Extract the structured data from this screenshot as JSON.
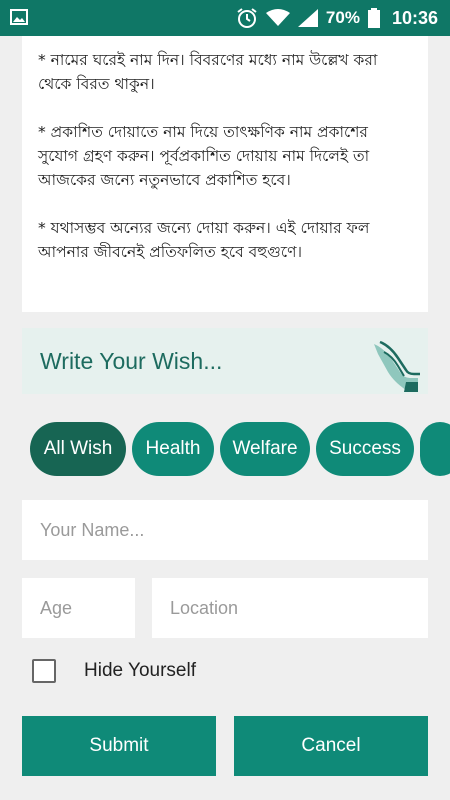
{
  "status_bar": {
    "battery": "70%",
    "time": "10:36",
    "icons": [
      "gallery-icon",
      "alarm-icon",
      "wifi-icon",
      "signal-icon",
      "battery-icon"
    ]
  },
  "info": {
    "paragraphs": [
      "* নামের ঘরেই নাম দিন। বিবরণের মধ্যে নাম উল্লেখ করা থেকে বিরত থাকুন।",
      "* প্রকাশিত দোয়াতে নাম দিয়ে তাৎক্ষণিক নাম প্রকাশের সুযোগ গ্রহণ করুন। পূর্বপ্রকাশিত দোয়ায় নাম দিলেই তা আজকের জন্যে নতুনভাবে প্রকাশিত হবে।",
      "* যথাসম্ভব অন্যের জন্যে দোয়া করুন। এই দোয়ার ফল আপনার জীবনেই প্রতিফলিত হবে বহুগুণে।"
    ]
  },
  "wish_header": {
    "title": "Write Your Wish...",
    "icon": "praying-hands-icon"
  },
  "categories": [
    {
      "label": "All Wish",
      "active": true
    },
    {
      "label": "Health",
      "active": false
    },
    {
      "label": "Welfare",
      "active": false
    },
    {
      "label": "Success",
      "active": false
    }
  ],
  "form": {
    "name_placeholder": "Your Name...",
    "age_placeholder": "Age",
    "location_placeholder": "Location",
    "hide_label": "Hide Yourself",
    "hide_checked": false,
    "submit_label": "Submit",
    "cancel_label": "Cancel"
  },
  "colors": {
    "primary": "#0f8a78",
    "status_bar": "#0f7766",
    "chip_active": "#176553",
    "header_bg": "#e6f1ee"
  }
}
